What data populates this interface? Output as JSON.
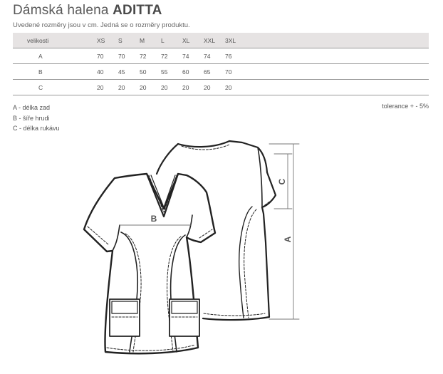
{
  "title": {
    "prefix": "Dámská halena",
    "product": "ADITTA"
  },
  "subtitle": "Uvedené rozměry jsou v cm. Jedná se o rozměry produktu.",
  "table": {
    "header_label": "velikosti",
    "sizes": [
      "XS",
      "S",
      "M",
      "L",
      "XL",
      "XXL",
      "3XL"
    ],
    "rows": [
      {
        "label": "A",
        "values": [
          "70",
          "70",
          "72",
          "72",
          "74",
          "74",
          "76"
        ]
      },
      {
        "label": "B",
        "values": [
          "40",
          "45",
          "50",
          "55",
          "60",
          "65",
          "70"
        ]
      },
      {
        "label": "C",
        "values": [
          "20",
          "20",
          "20",
          "20",
          "20",
          "20",
          "20"
        ]
      }
    ]
  },
  "legend": [
    "A - délka zad",
    "B - šíře hrudi",
    "C - délka rukávu"
  ],
  "tolerance": "tolerance + - 5%",
  "diagram_labels": {
    "A": "A",
    "B": "B",
    "C": "C"
  }
}
